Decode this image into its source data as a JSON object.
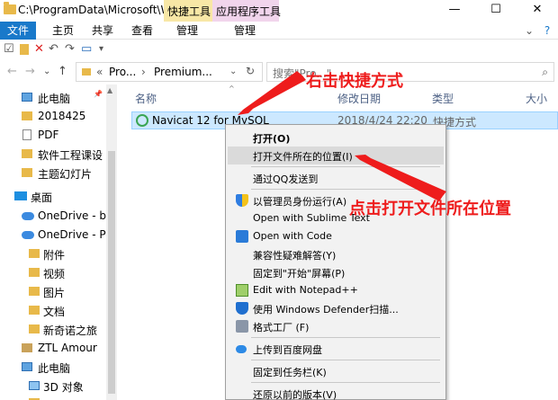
{
  "window": {
    "title": "C:\\ProgramData\\Microsoft\\Wi...",
    "context_tab_1": "快捷工具",
    "context_tab_2": "应用程序工具",
    "minimize": "—",
    "maximize": "☐",
    "close": "✕"
  },
  "ribbon": {
    "tabs": [
      "文件",
      "主页",
      "共享",
      "查看",
      "管理",
      "管理"
    ],
    "expand": "⌄",
    "help": "?"
  },
  "qat": {
    "check": "☑",
    "delete": "✕",
    "undo": "↶",
    "redo": "↷",
    "rename": "▭",
    "dropdown": "▾"
  },
  "address": {
    "back": "←",
    "forward": "→",
    "recent": "⌄",
    "up": "↑",
    "sep": "«",
    "crumb1": "Pro...",
    "crumb_arrow": "›",
    "crumb2": "Premium...",
    "dropdown": "⌄",
    "refresh": "↻",
    "search_placeholder": "搜索\"Pro...\"",
    "search_icon": "⌕"
  },
  "nav_pane": {
    "pin": "📌",
    "collapse": "^",
    "items": [
      {
        "label": "此电脑",
        "icon": "computer-icon"
      },
      {
        "label": "2018425",
        "icon": "folder-icon"
      },
      {
        "label": "PDF",
        "icon": "document-icon"
      },
      {
        "label": "软件工程课设",
        "icon": "folder-icon"
      },
      {
        "label": "主题幻灯片",
        "icon": "folder-icon"
      },
      {
        "label": "桌面",
        "icon": "desktop-icon"
      },
      {
        "label": "OneDrive - bus",
        "icon": "cloud-icon"
      },
      {
        "label": "OneDrive - Pers",
        "icon": "cloud-icon"
      },
      {
        "label": "附件",
        "icon": "folder-icon"
      },
      {
        "label": "视频",
        "icon": "folder-icon"
      },
      {
        "label": "图片",
        "icon": "folder-icon"
      },
      {
        "label": "文档",
        "icon": "folder-icon"
      },
      {
        "label": "新奇诺之旅",
        "icon": "folder-icon"
      },
      {
        "label": "ZTL Amour",
        "icon": "user-icon"
      },
      {
        "label": "此电脑",
        "icon": "computer-icon"
      },
      {
        "label": "3D 对象",
        "icon": "cube-icon"
      }
    ]
  },
  "file_list": {
    "columns": {
      "name": "名称",
      "date": "修改日期",
      "type": "类型",
      "size": "大小"
    },
    "sort_indicator": "^",
    "rows": [
      {
        "name": "Navicat 12 for MySQL",
        "date": "2018/4/24 22:20",
        "type": "快捷方式"
      }
    ]
  },
  "context_menu": {
    "items": [
      {
        "label": "打开(O)",
        "bold": true
      },
      {
        "label": "打开文件所在的位置(I)",
        "highlighted": true
      },
      {
        "label": "通过QQ发送到"
      },
      {
        "label": "以管理员身份运行(A)"
      },
      {
        "label": "Open with Sublime Text"
      },
      {
        "label": "Open with Code"
      },
      {
        "label": "兼容性疑难解答(Y)"
      },
      {
        "label": "固定到\"开始\"屏幕(P)"
      },
      {
        "label": "Edit with Notepad++"
      },
      {
        "label": "使用 Windows Defender扫描..."
      },
      {
        "label": "格式工厂 (F)"
      },
      {
        "label": "上传到百度网盘"
      },
      {
        "label": "固定到任务栏(K)"
      },
      {
        "label": "还原以前的版本(V)"
      }
    ]
  },
  "annotations": {
    "top": "右击快捷方式",
    "middle": "点击打开文件所在位置"
  },
  "colors": {
    "accent": "#1979ca",
    "selection": "#cce8ff",
    "annotation": "#ee1c1c",
    "context_tab_1": "#f8e7a6",
    "context_tab_2": "#f1d5ec"
  }
}
